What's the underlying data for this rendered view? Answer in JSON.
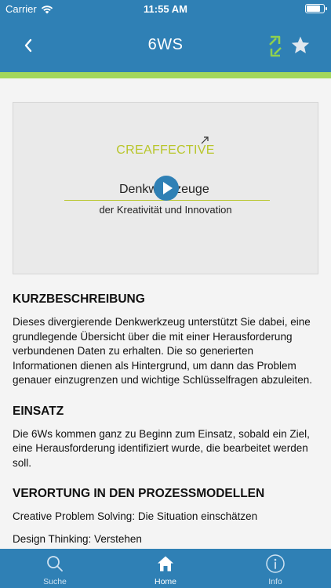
{
  "status_bar": {
    "carrier": "Carrier",
    "time": "11:55 AM",
    "battery_level": 0.9
  },
  "nav": {
    "title": "6WS",
    "back_icon": "chevron-left-icon",
    "share_icon": "share-arrows-icon",
    "favorite_icon": "star-icon"
  },
  "video": {
    "brand": "CREAFFECTIVE",
    "title": "Denkwerkzeuge",
    "subtitle": "der Kreativität und Innovation",
    "play_icon": "play-icon"
  },
  "sections": [
    {
      "heading": "KURZBESCHREIBUNG",
      "text": "Dieses divergierende Denkwerkzeug unterstützt Sie dabei, eine grundlegende Übersicht über die mit einer Herausforderung verbundenen Daten zu erhalten. Die so generierten Informationen dienen als Hintergrund, um dann das Problem genauer einzugrenzen und wichtige Schlüsselfragen abzuleiten."
    },
    {
      "heading": "EINSATZ",
      "text": "Die 6Ws kommen ganz zu Beginn zum Einsatz, sobald ein Ziel, eine Herausforderung identifiziert wurde, die bearbeitet werden soll."
    },
    {
      "heading": "VERORTUNG IN DEN PROZESSMODELLEN",
      "lines": [
        "Creative Problem Solving: Die Situation einschätzen",
        "Design Thinking: Verstehen"
      ]
    }
  ],
  "tabbar": {
    "tabs": [
      {
        "label": "Suche",
        "icon": "search-icon"
      },
      {
        "label": "Home",
        "icon": "home-icon"
      },
      {
        "label": "Info",
        "icon": "info-icon"
      }
    ],
    "active": "Home"
  },
  "colors": {
    "primary": "#2f80b5",
    "accent_green": "#a3d65c",
    "brand_yellow": "#b8c62a",
    "share_green": "#8fd14f"
  }
}
